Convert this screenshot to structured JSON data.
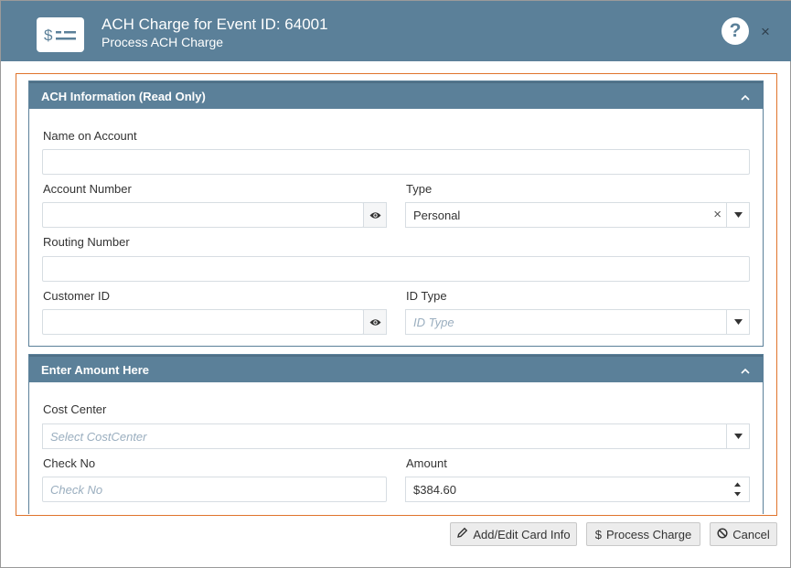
{
  "header": {
    "title": "ACH Charge for Event ID: 64001",
    "subtitle": "Process ACH Charge",
    "icon": "dollar-card-icon",
    "help_label": "?",
    "close_label": "×"
  },
  "colors": {
    "header_bg": "#5b8099",
    "frame_border": "#e0742c",
    "placeholder": "#9aaebf"
  },
  "ach_panel": {
    "title": "ACH Information (Read Only)",
    "name_on_account_label": "Name on Account",
    "name_on_account_value": "",
    "account_number_label": "Account Number",
    "account_number_value": "",
    "type_label": "Type",
    "type_value": "Personal",
    "routing_number_label": "Routing Number",
    "routing_number_value": "",
    "customer_id_label": "Customer ID",
    "customer_id_value": "",
    "id_type_label": "ID Type",
    "id_type_placeholder": "ID Type"
  },
  "amount_panel": {
    "title": "Enter Amount Here",
    "cost_center_label": "Cost Center",
    "cost_center_placeholder": "Select CostCenter",
    "check_no_label": "Check No",
    "check_no_placeholder": "Check No",
    "amount_label": "Amount",
    "amount_value": "$384.60"
  },
  "footer": {
    "add_edit_label": "Add/Edit Card Info",
    "process_label": "Process Charge",
    "cancel_label": "Cancel"
  }
}
